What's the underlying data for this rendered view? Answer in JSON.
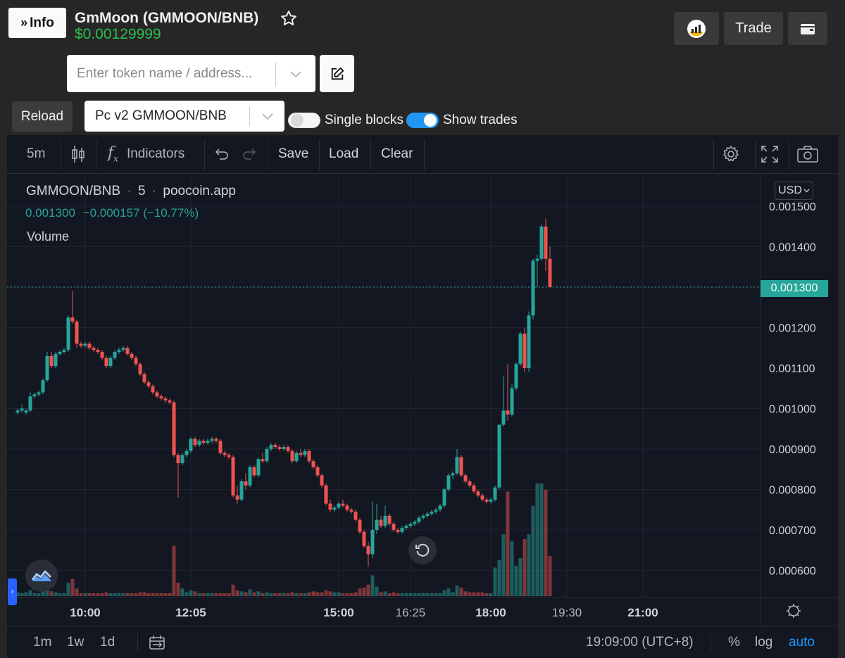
{
  "header": {
    "info_label": "Info",
    "title": "GmMoon (GMMOON/BNB)",
    "price": "$0.00129999",
    "trade_label": "Trade",
    "icons": {
      "chart": "chart-logo-icon",
      "wallet": "wallet-icon",
      "star": "star-icon",
      "edit": "edit-icon"
    }
  },
  "search": {
    "placeholder": "Enter token name / address..."
  },
  "controls": {
    "reload_label": "Reload",
    "pair_value": "Pc v2 GMMOON/BNB",
    "single_blocks_label": "Single blocks",
    "single_blocks_on": false,
    "show_trades_label": "Show trades",
    "show_trades_on": true
  },
  "toolbar": {
    "interval": "5m",
    "indicators_label": "Indicators",
    "save_label": "Save",
    "load_label": "Load",
    "clear_label": "Clear"
  },
  "legend": {
    "symbol": "GMMOON/BNB",
    "interval": "5",
    "source": "poocoin.app",
    "last": "0.001300",
    "change": "−0.000157 (−10.77%)",
    "volume_label": "Volume"
  },
  "currency_label": "USD",
  "last_price_label": "0.001300",
  "bottom_bar": {
    "ranges": [
      "1m",
      "1w",
      "1d"
    ],
    "time": "19:09:00 (UTC+8)",
    "percent": "%",
    "log": "log",
    "auto": "auto"
  },
  "colors": {
    "up": "#26a69a",
    "down": "#ef5350",
    "accent": "#2196f3",
    "price_green": "#2ebd4e"
  },
  "chart_data": {
    "type": "candlestick",
    "y_axis_labels": [
      "0.001500",
      "0.001400",
      "0.001300",
      "0.001200",
      "0.001100",
      "0.001000",
      "0.000900",
      "0.000800",
      "0.000700",
      "0.000600"
    ],
    "x_axis_labels": [
      {
        "label": "10:00",
        "t": 600,
        "bold": true
      },
      {
        "label": "12:05",
        "t": 725,
        "bold": true
      },
      {
        "label": "15:00",
        "t": 900,
        "bold": true
      },
      {
        "label": "16:25",
        "t": 985,
        "bold": false
      },
      {
        "label": "18:00",
        "t": 1080,
        "bold": true
      },
      {
        "label": "19:30",
        "t": 1170,
        "bold": false
      },
      {
        "label": "21:00",
        "t": 1260,
        "bold": true
      }
    ],
    "last_price": 0.0013,
    "candles": [
      {
        "t": 520,
        "o": 0.00099,
        "h": 0.001,
        "l": 0.000985,
        "c": 0.000995,
        "v": 4
      },
      {
        "t": 525,
        "o": 0.000995,
        "h": 0.00101,
        "l": 0.00099,
        "c": 0.001,
        "v": 3
      },
      {
        "t": 530,
        "o": 0.00099,
        "h": 0.001,
        "l": 0.000985,
        "c": 0.000995,
        "v": 4
      },
      {
        "t": 535,
        "o": 0.000995,
        "h": 0.00104,
        "l": 0.00099,
        "c": 0.00103,
        "v": 6
      },
      {
        "t": 540,
        "o": 0.00103,
        "h": 0.00104,
        "l": 0.001025,
        "c": 0.001035,
        "v": 3
      },
      {
        "t": 545,
        "o": 0.001035,
        "h": 0.001045,
        "l": 0.00103,
        "c": 0.00104,
        "v": 3
      },
      {
        "t": 550,
        "o": 0.00104,
        "h": 0.001075,
        "l": 0.001035,
        "c": 0.00107,
        "v": 5
      },
      {
        "t": 555,
        "o": 0.00107,
        "h": 0.00114,
        "l": 0.001065,
        "c": 0.00113,
        "v": 9
      },
      {
        "t": 560,
        "o": 0.00113,
        "h": 0.00114,
        "l": 0.0011,
        "c": 0.001105,
        "v": 5
      },
      {
        "t": 565,
        "o": 0.001105,
        "h": 0.00114,
        "l": 0.0011,
        "c": 0.001135,
        "v": 4
      },
      {
        "t": 570,
        "o": 0.001135,
        "h": 0.001145,
        "l": 0.00113,
        "c": 0.00114,
        "v": 3
      },
      {
        "t": 575,
        "o": 0.00114,
        "h": 0.00115,
        "l": 0.001135,
        "c": 0.001145,
        "v": 3
      },
      {
        "t": 580,
        "o": 0.001145,
        "h": 0.00123,
        "l": 0.00114,
        "c": 0.001225,
        "v": 14
      },
      {
        "t": 585,
        "o": 0.001225,
        "h": 0.00129,
        "l": 0.00121,
        "c": 0.001215,
        "v": 18
      },
      {
        "t": 590,
        "o": 0.001215,
        "h": 0.00122,
        "l": 0.00115,
        "c": 0.00116,
        "v": 8
      },
      {
        "t": 595,
        "o": 0.00116,
        "h": 0.001165,
        "l": 0.00115,
        "c": 0.001155,
        "v": 3
      },
      {
        "t": 600,
        "o": 0.001155,
        "h": 0.001165,
        "l": 0.00115,
        "c": 0.00116,
        "v": 3
      },
      {
        "t": 605,
        "o": 0.00116,
        "h": 0.001165,
        "l": 0.001145,
        "c": 0.00115,
        "v": 3
      },
      {
        "t": 610,
        "o": 0.00115,
        "h": 0.001155,
        "l": 0.00114,
        "c": 0.001145,
        "v": 3
      },
      {
        "t": 615,
        "o": 0.001145,
        "h": 0.00115,
        "l": 0.001135,
        "c": 0.00114,
        "v": 3
      },
      {
        "t": 620,
        "o": 0.00114,
        "h": 0.001145,
        "l": 0.00112,
        "c": 0.001125,
        "v": 3
      },
      {
        "t": 625,
        "o": 0.001125,
        "h": 0.00113,
        "l": 0.0011,
        "c": 0.001105,
        "v": 4
      },
      {
        "t": 630,
        "o": 0.001105,
        "h": 0.00113,
        "l": 0.0011,
        "c": 0.001125,
        "v": 3
      },
      {
        "t": 635,
        "o": 0.001125,
        "h": 0.001145,
        "l": 0.00112,
        "c": 0.00114,
        "v": 3
      },
      {
        "t": 640,
        "o": 0.00114,
        "h": 0.00115,
        "l": 0.001135,
        "c": 0.001145,
        "v": 3
      },
      {
        "t": 645,
        "o": 0.001145,
        "h": 0.001155,
        "l": 0.00114,
        "c": 0.00115,
        "v": 3
      },
      {
        "t": 650,
        "o": 0.00115,
        "h": 0.001155,
        "l": 0.00113,
        "c": 0.001135,
        "v": 3
      },
      {
        "t": 655,
        "o": 0.001135,
        "h": 0.00114,
        "l": 0.00112,
        "c": 0.001125,
        "v": 3
      },
      {
        "t": 660,
        "o": 0.001125,
        "h": 0.00113,
        "l": 0.001105,
        "c": 0.00111,
        "v": 3
      },
      {
        "t": 665,
        "o": 0.00111,
        "h": 0.001115,
        "l": 0.00108,
        "c": 0.001085,
        "v": 4
      },
      {
        "t": 670,
        "o": 0.001085,
        "h": 0.00109,
        "l": 0.00106,
        "c": 0.001065,
        "v": 4
      },
      {
        "t": 675,
        "o": 0.001065,
        "h": 0.00107,
        "l": 0.00105,
        "c": 0.001055,
        "v": 3
      },
      {
        "t": 680,
        "o": 0.001055,
        "h": 0.00106,
        "l": 0.001035,
        "c": 0.00104,
        "v": 3
      },
      {
        "t": 685,
        "o": 0.00104,
        "h": 0.001045,
        "l": 0.001025,
        "c": 0.00103,
        "v": 3
      },
      {
        "t": 690,
        "o": 0.00103,
        "h": 0.001035,
        "l": 0.00102,
        "c": 0.001025,
        "v": 3
      },
      {
        "t": 695,
        "o": 0.001025,
        "h": 0.00103,
        "l": 0.001015,
        "c": 0.00102,
        "v": 3
      },
      {
        "t": 700,
        "o": 0.00102,
        "h": 0.001025,
        "l": 0.00101,
        "c": 0.001015,
        "v": 3
      },
      {
        "t": 705,
        "o": 0.001015,
        "h": 0.00102,
        "l": 0.00088,
        "c": 0.000885,
        "v": 53
      },
      {
        "t": 710,
        "o": 0.000885,
        "h": 0.00089,
        "l": 0.00078,
        "c": 0.000865,
        "v": 14
      },
      {
        "t": 715,
        "o": 0.000865,
        "h": 0.00089,
        "l": 0.00086,
        "c": 0.000885,
        "v": 8
      },
      {
        "t": 720,
        "o": 0.000885,
        "h": 0.0009,
        "l": 0.00088,
        "c": 0.000895,
        "v": 4
      },
      {
        "t": 725,
        "o": 0.000895,
        "h": 0.00093,
        "l": 0.00089,
        "c": 0.000925,
        "v": 6
      },
      {
        "t": 730,
        "o": 0.000925,
        "h": 0.00093,
        "l": 0.000905,
        "c": 0.00091,
        "v": 5
      },
      {
        "t": 735,
        "o": 0.00091,
        "h": 0.000925,
        "l": 0.000905,
        "c": 0.00092,
        "v": 3
      },
      {
        "t": 740,
        "o": 0.00092,
        "h": 0.000925,
        "l": 0.00091,
        "c": 0.000915,
        "v": 3
      },
      {
        "t": 745,
        "o": 0.000915,
        "h": 0.000925,
        "l": 0.00091,
        "c": 0.00092,
        "v": 3
      },
      {
        "t": 750,
        "o": 0.00092,
        "h": 0.00093,
        "l": 0.000915,
        "c": 0.000925,
        "v": 3
      },
      {
        "t": 755,
        "o": 0.000925,
        "h": 0.00093,
        "l": 0.000915,
        "c": 0.00092,
        "v": 3
      },
      {
        "t": 760,
        "o": 0.00092,
        "h": 0.000925,
        "l": 0.000885,
        "c": 0.00089,
        "v": 3
      },
      {
        "t": 765,
        "o": 0.00089,
        "h": 0.000895,
        "l": 0.00088,
        "c": 0.000885,
        "v": 3
      },
      {
        "t": 770,
        "o": 0.000885,
        "h": 0.00089,
        "l": 0.000875,
        "c": 0.00088,
        "v": 3
      },
      {
        "t": 775,
        "o": 0.00088,
        "h": 0.000885,
        "l": 0.00078,
        "c": 0.000785,
        "v": 12
      },
      {
        "t": 780,
        "o": 0.000785,
        "h": 0.00081,
        "l": 0.000765,
        "c": 0.000775,
        "v": 6
      },
      {
        "t": 785,
        "o": 0.000775,
        "h": 0.000825,
        "l": 0.00077,
        "c": 0.00082,
        "v": 5
      },
      {
        "t": 790,
        "o": 0.00082,
        "h": 0.00084,
        "l": 0.0008,
        "c": 0.00081,
        "v": 4
      },
      {
        "t": 795,
        "o": 0.00081,
        "h": 0.00086,
        "l": 0.000805,
        "c": 0.000855,
        "v": 7
      },
      {
        "t": 800,
        "o": 0.000855,
        "h": 0.00086,
        "l": 0.00083,
        "c": 0.000835,
        "v": 4
      },
      {
        "t": 805,
        "o": 0.000835,
        "h": 0.00088,
        "l": 0.00083,
        "c": 0.000875,
        "v": 5
      },
      {
        "t": 810,
        "o": 0.000875,
        "h": 0.00089,
        "l": 0.000865,
        "c": 0.00087,
        "v": 3
      },
      {
        "t": 815,
        "o": 0.00087,
        "h": 0.000905,
        "l": 0.000865,
        "c": 0.0009,
        "v": 4
      },
      {
        "t": 820,
        "o": 0.0009,
        "h": 0.000915,
        "l": 0.000895,
        "c": 0.00091,
        "v": 3
      },
      {
        "t": 825,
        "o": 0.00091,
        "h": 0.000915,
        "l": 0.0009,
        "c": 0.000905,
        "v": 3
      },
      {
        "t": 830,
        "o": 0.000905,
        "h": 0.00091,
        "l": 0.000895,
        "c": 0.0009,
        "v": 3
      },
      {
        "t": 835,
        "o": 0.0009,
        "h": 0.00091,
        "l": 0.000895,
        "c": 0.000905,
        "v": 3
      },
      {
        "t": 840,
        "o": 0.000905,
        "h": 0.00091,
        "l": 0.00089,
        "c": 0.000895,
        "v": 3
      },
      {
        "t": 845,
        "o": 0.000895,
        "h": 0.0009,
        "l": 0.000865,
        "c": 0.00087,
        "v": 4
      },
      {
        "t": 850,
        "o": 0.00087,
        "h": 0.000895,
        "l": 0.000865,
        "c": 0.00089,
        "v": 3
      },
      {
        "t": 855,
        "o": 0.00089,
        "h": 0.0009,
        "l": 0.00088,
        "c": 0.000885,
        "v": 3
      },
      {
        "t": 860,
        "o": 0.000885,
        "h": 0.0009,
        "l": 0.00088,
        "c": 0.000895,
        "v": 3
      },
      {
        "t": 865,
        "o": 0.000895,
        "h": 0.0009,
        "l": 0.000865,
        "c": 0.00087,
        "v": 4
      },
      {
        "t": 870,
        "o": 0.00087,
        "h": 0.000875,
        "l": 0.00085,
        "c": 0.000855,
        "v": 5
      },
      {
        "t": 875,
        "o": 0.000855,
        "h": 0.00086,
        "l": 0.00083,
        "c": 0.000835,
        "v": 4
      },
      {
        "t": 880,
        "o": 0.000835,
        "h": 0.00084,
        "l": 0.000805,
        "c": 0.00081,
        "v": 4
      },
      {
        "t": 885,
        "o": 0.00081,
        "h": 0.000815,
        "l": 0.00076,
        "c": 0.000765,
        "v": 6
      },
      {
        "t": 890,
        "o": 0.000765,
        "h": 0.000775,
        "l": 0.000745,
        "c": 0.00075,
        "v": 5
      },
      {
        "t": 895,
        "o": 0.00075,
        "h": 0.00076,
        "l": 0.000745,
        "c": 0.000755,
        "v": 4
      },
      {
        "t": 900,
        "o": 0.000755,
        "h": 0.00077,
        "l": 0.00075,
        "c": 0.000765,
        "v": 4
      },
      {
        "t": 905,
        "o": 0.000765,
        "h": 0.000775,
        "l": 0.000755,
        "c": 0.00076,
        "v": 3
      },
      {
        "t": 910,
        "o": 0.00076,
        "h": 0.000765,
        "l": 0.000745,
        "c": 0.00075,
        "v": 3
      },
      {
        "t": 915,
        "o": 0.00075,
        "h": 0.000755,
        "l": 0.00074,
        "c": 0.000745,
        "v": 3
      },
      {
        "t": 920,
        "o": 0.000745,
        "h": 0.00075,
        "l": 0.00072,
        "c": 0.000725,
        "v": 4
      },
      {
        "t": 925,
        "o": 0.000725,
        "h": 0.00073,
        "l": 0.00069,
        "c": 0.000695,
        "v": 8
      },
      {
        "t": 930,
        "o": 0.000695,
        "h": 0.0007,
        "l": 0.000655,
        "c": 0.00066,
        "v": 9
      },
      {
        "t": 935,
        "o": 0.00066,
        "h": 0.00067,
        "l": 0.00061,
        "c": 0.00064,
        "v": 12
      },
      {
        "t": 940,
        "o": 0.00064,
        "h": 0.00077,
        "l": 0.00063,
        "c": 0.0007,
        "v": 22
      },
      {
        "t": 945,
        "o": 0.0007,
        "h": 0.000765,
        "l": 0.00069,
        "c": 0.000725,
        "v": 10
      },
      {
        "t": 950,
        "o": 0.000725,
        "h": 0.000735,
        "l": 0.000705,
        "c": 0.00071,
        "v": 4
      },
      {
        "t": 955,
        "o": 0.00071,
        "h": 0.00076,
        "l": 0.000705,
        "c": 0.000735,
        "v": 5
      },
      {
        "t": 960,
        "o": 0.000735,
        "h": 0.00074,
        "l": 0.00071,
        "c": 0.000715,
        "v": 3
      },
      {
        "t": 965,
        "o": 0.000715,
        "h": 0.00072,
        "l": 0.000695,
        "c": 0.0007,
        "v": 4
      },
      {
        "t": 970,
        "o": 0.0007,
        "h": 0.000705,
        "l": 0.00069,
        "c": 0.000695,
        "v": 3
      },
      {
        "t": 975,
        "o": 0.000695,
        "h": 0.00071,
        "l": 0.00069,
        "c": 0.000705,
        "v": 3
      },
      {
        "t": 980,
        "o": 0.000705,
        "h": 0.000715,
        "l": 0.0007,
        "c": 0.00071,
        "v": 3
      },
      {
        "t": 985,
        "o": 0.00071,
        "h": 0.00072,
        "l": 0.000705,
        "c": 0.000715,
        "v": 3
      },
      {
        "t": 990,
        "o": 0.000715,
        "h": 0.000725,
        "l": 0.00071,
        "c": 0.00072,
        "v": 3
      },
      {
        "t": 995,
        "o": 0.00072,
        "h": 0.000735,
        "l": 0.000715,
        "c": 0.00073,
        "v": 3
      },
      {
        "t": 1000,
        "o": 0.00073,
        "h": 0.00074,
        "l": 0.000725,
        "c": 0.000735,
        "v": 3
      },
      {
        "t": 1005,
        "o": 0.000735,
        "h": 0.000745,
        "l": 0.00073,
        "c": 0.00074,
        "v": 3
      },
      {
        "t": 1010,
        "o": 0.00074,
        "h": 0.00075,
        "l": 0.000735,
        "c": 0.000745,
        "v": 3
      },
      {
        "t": 1015,
        "o": 0.000745,
        "h": 0.000755,
        "l": 0.00074,
        "c": 0.00075,
        "v": 3
      },
      {
        "t": 1020,
        "o": 0.00075,
        "h": 0.000765,
        "l": 0.000745,
        "c": 0.00076,
        "v": 3
      },
      {
        "t": 1025,
        "o": 0.00076,
        "h": 0.000805,
        "l": 0.000755,
        "c": 0.0008,
        "v": 6
      },
      {
        "t": 1030,
        "o": 0.0008,
        "h": 0.00084,
        "l": 0.000795,
        "c": 0.000835,
        "v": 8
      },
      {
        "t": 1035,
        "o": 0.000835,
        "h": 0.000845,
        "l": 0.000825,
        "c": 0.00084,
        "v": 4
      },
      {
        "t": 1040,
        "o": 0.00084,
        "h": 0.0009,
        "l": 0.000835,
        "c": 0.00088,
        "v": 11
      },
      {
        "t": 1045,
        "o": 0.00088,
        "h": 0.000885,
        "l": 0.00083,
        "c": 0.000835,
        "v": 9
      },
      {
        "t": 1050,
        "o": 0.000835,
        "h": 0.00084,
        "l": 0.000815,
        "c": 0.00082,
        "v": 5
      },
      {
        "t": 1055,
        "o": 0.00082,
        "h": 0.000825,
        "l": 0.000805,
        "c": 0.00081,
        "v": 4
      },
      {
        "t": 1060,
        "o": 0.00081,
        "h": 0.000815,
        "l": 0.00079,
        "c": 0.000795,
        "v": 4
      },
      {
        "t": 1065,
        "o": 0.000795,
        "h": 0.0008,
        "l": 0.00078,
        "c": 0.000785,
        "v": 4
      },
      {
        "t": 1070,
        "o": 0.000785,
        "h": 0.00079,
        "l": 0.00077,
        "c": 0.000775,
        "v": 4
      },
      {
        "t": 1075,
        "o": 0.000775,
        "h": 0.00078,
        "l": 0.000765,
        "c": 0.00077,
        "v": 3
      },
      {
        "t": 1080,
        "o": 0.00077,
        "h": 0.00078,
        "l": 0.000765,
        "c": 0.000775,
        "v": 3
      },
      {
        "t": 1085,
        "o": 0.000775,
        "h": 0.00081,
        "l": 0.00077,
        "c": 0.000805,
        "v": 30
      },
      {
        "t": 1090,
        "o": 0.000805,
        "h": 0.00096,
        "l": 0.0008,
        "c": 0.00096,
        "v": 38
      },
      {
        "t": 1095,
        "o": 0.00096,
        "h": 0.00108,
        "l": 0.000955,
        "c": 0.000995,
        "v": 65
      },
      {
        "t": 1100,
        "o": 0.000995,
        "h": 0.00111,
        "l": 0.00097,
        "c": 0.000985,
        "v": 110
      },
      {
        "t": 1105,
        "o": 0.000985,
        "h": 0.00106,
        "l": 0.00098,
        "c": 0.00105,
        "v": 58
      },
      {
        "t": 1110,
        "o": 0.00105,
        "h": 0.001115,
        "l": 0.001045,
        "c": 0.00111,
        "v": 32
      },
      {
        "t": 1115,
        "o": 0.00111,
        "h": 0.00119,
        "l": 0.001105,
        "c": 0.001185,
        "v": 40
      },
      {
        "t": 1120,
        "o": 0.001185,
        "h": 0.0012,
        "l": 0.00109,
        "c": 0.0011,
        "v": 60
      },
      {
        "t": 1125,
        "o": 0.0011,
        "h": 0.00124,
        "l": 0.00109,
        "c": 0.00123,
        "v": 65
      },
      {
        "t": 1130,
        "o": 0.00123,
        "h": 0.00137,
        "l": 0.00122,
        "c": 0.001365,
        "v": 95
      },
      {
        "t": 1135,
        "o": 0.001365,
        "h": 0.00138,
        "l": 0.0013,
        "c": 0.00137,
        "v": 150
      },
      {
        "t": 1140,
        "o": 0.00137,
        "h": 0.001455,
        "l": 0.001365,
        "c": 0.00145,
        "v": 125
      },
      {
        "t": 1145,
        "o": 0.00145,
        "h": 0.00147,
        "l": 0.00134,
        "c": 0.00137,
        "v": 112
      },
      {
        "t": 1150,
        "o": 0.00137,
        "h": 0.0014,
        "l": 0.0013,
        "c": 0.0013,
        "v": 42
      }
    ]
  }
}
